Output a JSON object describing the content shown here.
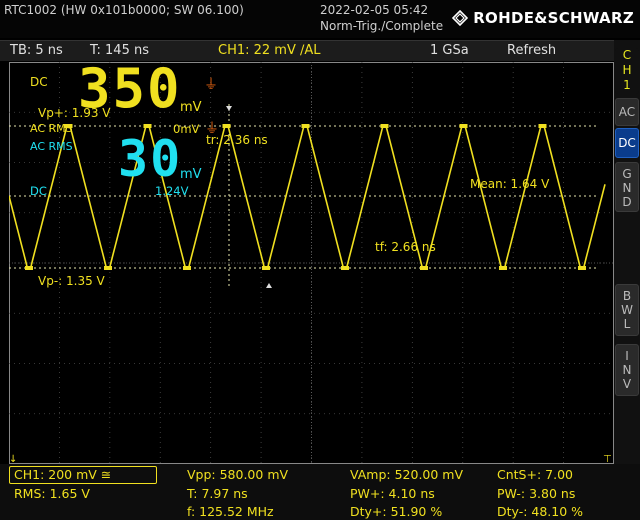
{
  "header": {
    "device": "RTC1002 (HW 0x101b0000; SW 06.100)",
    "datetime": "2022-02-05 05:42",
    "trigger_status": "Norm-Trig./Complete",
    "brand": "ROHDE&SCHWARZ"
  },
  "status": {
    "timebase": "TB: 5 ns",
    "trigger_time": "T: 145 ns",
    "ch1_trigger": "CH1: 22 mV ∕AL",
    "sample_rate": "1 GSa",
    "acq_mode": "Refresh"
  },
  "sidebar": {
    "channel": [
      "C",
      "H",
      "1"
    ],
    "ac": "AC",
    "dc": "DC",
    "gnd": [
      "G",
      "N",
      "D"
    ],
    "bwl": [
      "B",
      "W",
      "L"
    ],
    "inv": [
      "I",
      "N",
      "V"
    ]
  },
  "overlay": {
    "dc_label": "DC",
    "vpp_value": "350",
    "vpp_unit": "mV",
    "vp_plus": "Vp+: 1.93 V",
    "ac_rms_a": "AC RMS",
    "zero_mv": "0mV",
    "ac_rms_b": "AC RMS",
    "rms_value": "30",
    "rms_unit": "mV",
    "dc_label2": "DC",
    "dc_value": "1.24V",
    "tr": "tr: 2.36 ns",
    "mean": "Mean: 1.64 V",
    "tf": "tf: 2.66 ns",
    "vp_minus": "Vp-: 1.35 V"
  },
  "footer": {
    "ch1_setting": "CH1: 200 mV ≅",
    "rms": "RMS: 1.65 V",
    "vpp": "Vpp: 580.00 mV",
    "period": "T: 7.97 ns",
    "freq": "f: 125.52 MHz",
    "vamp": "VAmp: 520.00 mV",
    "pw_plus": "PW+: 4.10 ns",
    "dty_plus": "Dty+: 51.90 %",
    "cnts_plus": "CntS+: 7.00",
    "pw_minus": "PW-: 3.80 ns",
    "dty_minus": "Dty-: 48.10 %"
  },
  "colors": {
    "trace": "#f0e020",
    "rms_overlay": "#20e0f0",
    "grid": "#4a4a4a",
    "active_button": "#0a3c8c"
  }
}
